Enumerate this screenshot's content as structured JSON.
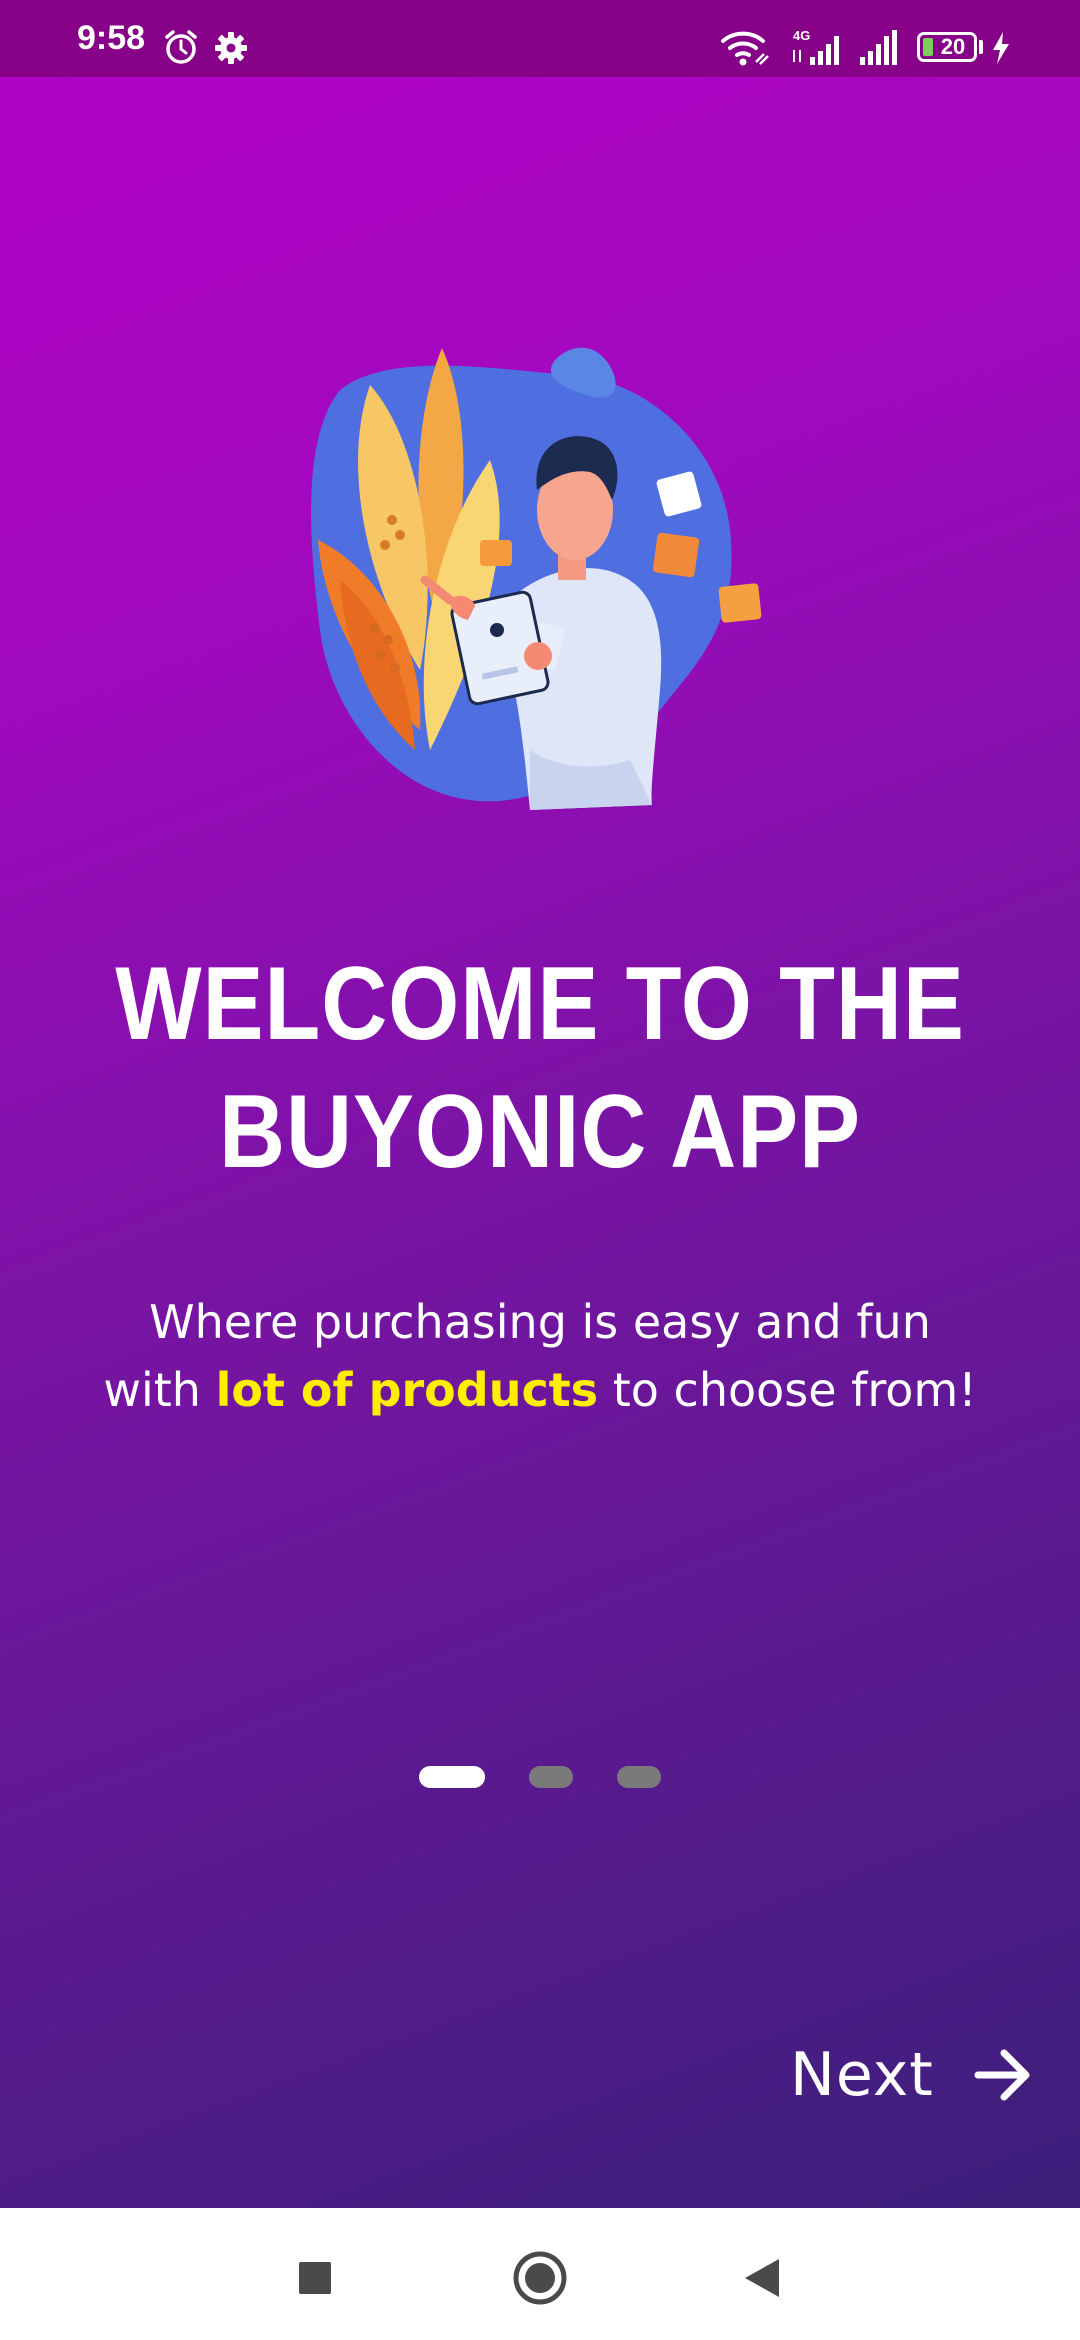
{
  "status_bar": {
    "time": "9:58",
    "icons": [
      "alarm-icon",
      "settings-gear-icon",
      "wifi-icon",
      "4g-signal-icon",
      "signal-icon",
      "battery-icon",
      "charging-bolt-icon"
    ],
    "network_label": "4G",
    "battery_level": "20",
    "background_color": "#860088"
  },
  "onboarding": {
    "illustration": "person-with-tablet-illustration",
    "title_line1": "WELCOME TO THE",
    "title_line2": "BUYONIC APP",
    "subtitle_line1": "Where purchasing is easy and fun",
    "subtitle_line2_before": "with ",
    "subtitle_highlight": "lot of products",
    "subtitle_line2_after": " to choose from!",
    "highlight_color": "#ffee00",
    "pages_total": 3,
    "current_page": 1,
    "next_label": "Next",
    "gradient_colors": [
      "#b100c4",
      "#3b1f7a"
    ]
  },
  "nav_bar": {
    "buttons": [
      "recent-apps-square-icon",
      "home-circle-icon",
      "back-triangle-icon"
    ]
  }
}
